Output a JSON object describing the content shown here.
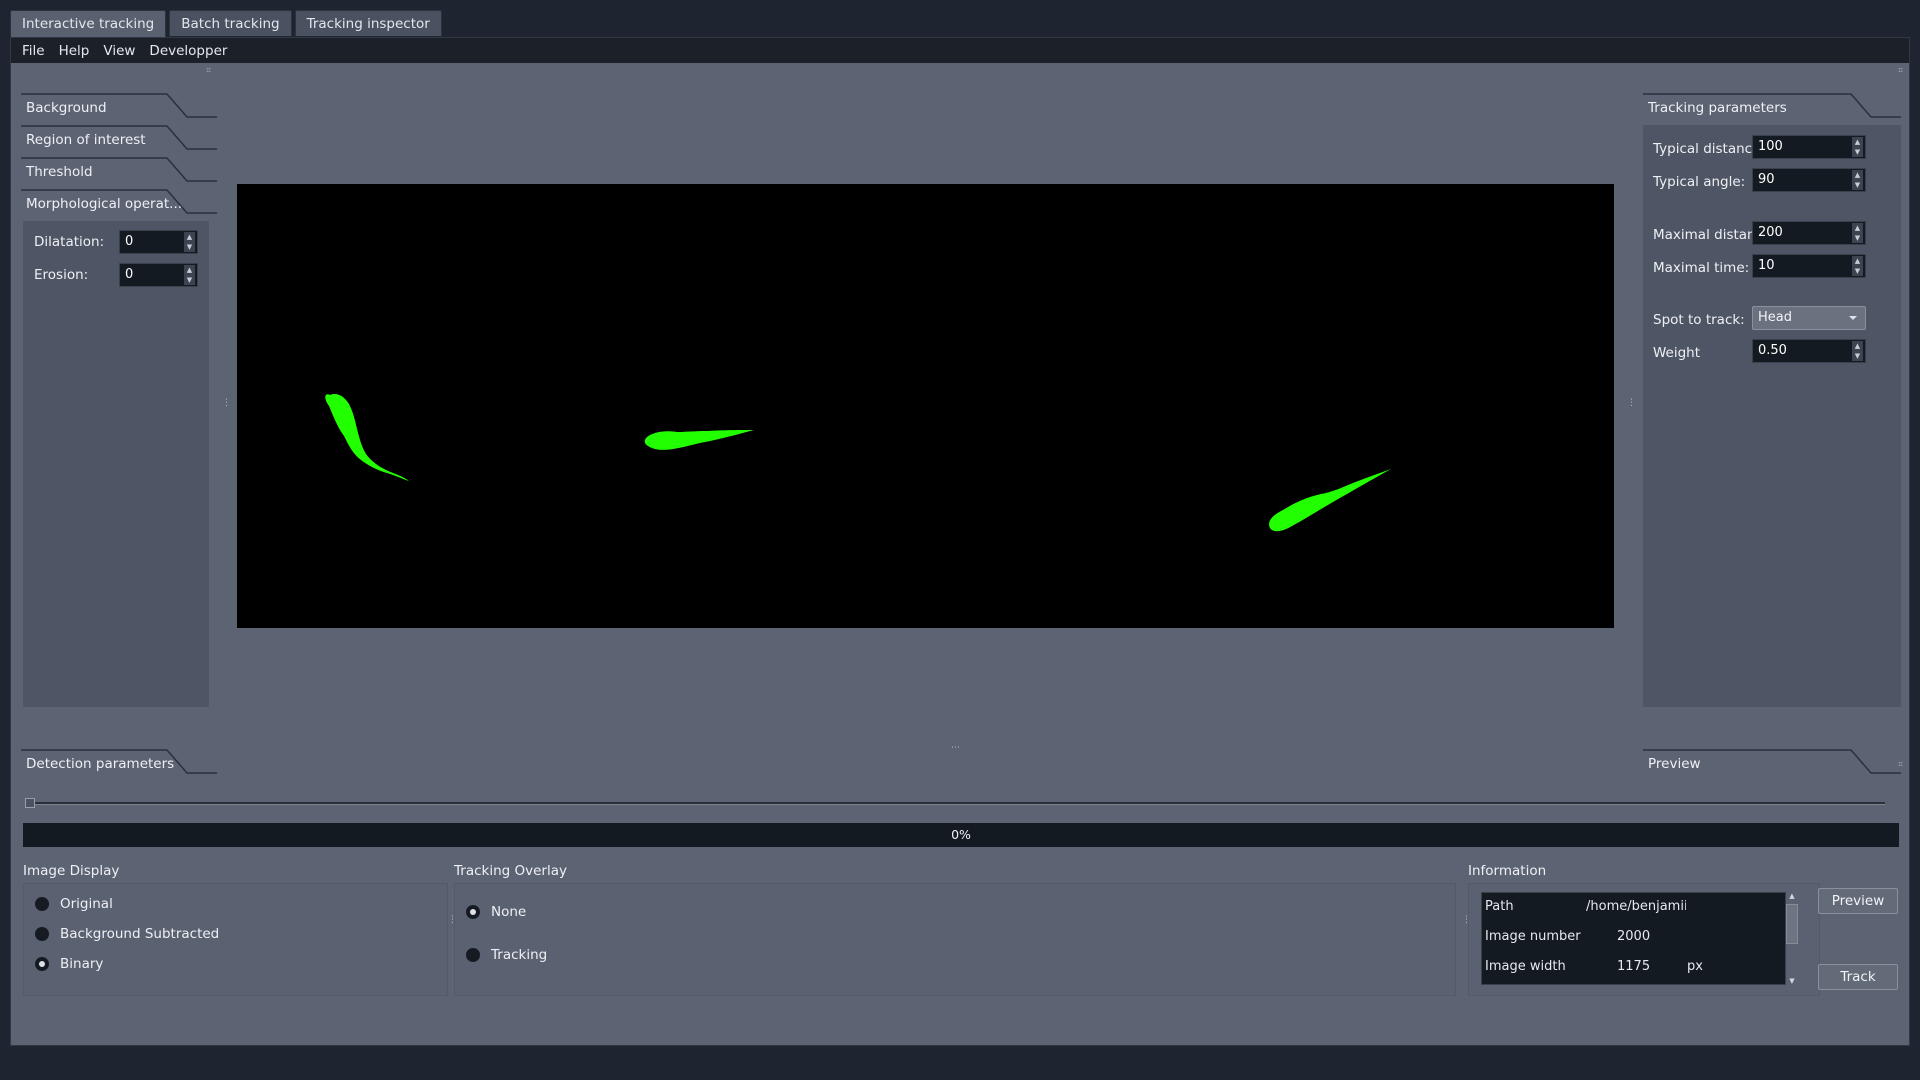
{
  "tabs": [
    "Interactive tracking",
    "Batch tracking",
    "Tracking inspector"
  ],
  "menu": [
    "File",
    "Help",
    "View",
    "Developper"
  ],
  "left_panel": {
    "sections": [
      "Background",
      "Region of interest",
      "Threshold",
      "Morphological operat..."
    ],
    "fields": [
      {
        "label": "Dilatation:",
        "value": "0"
      },
      {
        "label": "Erosion:",
        "value": "0"
      }
    ],
    "bottom_tab": "Detection parameters"
  },
  "right_panel": {
    "title": "Tracking parameters",
    "fields": [
      {
        "label": "Typical distance:",
        "value": "100"
      },
      {
        "label": "Typical angle:",
        "value": "90"
      },
      {
        "label": "Maximal distance:",
        "value": "200"
      },
      {
        "label": "Maximal time:",
        "value": "10"
      }
    ],
    "spot_label": "Spot to track:",
    "spot_value": "Head",
    "weight_label": "Weight",
    "weight_value": "0.50",
    "bottom_tab": "Preview"
  },
  "progress": {
    "text": "0%",
    "fraction": 0
  },
  "slider": {
    "value": 0
  },
  "image_display": {
    "title": "Image Display",
    "options": [
      {
        "label": "Original",
        "checked": false
      },
      {
        "label": "Background Subtracted",
        "checked": false
      },
      {
        "label": "Binary",
        "checked": true
      }
    ]
  },
  "tracking_overlay": {
    "title": "Tracking Overlay",
    "options": [
      {
        "label": "None",
        "checked": true
      },
      {
        "label": "Tracking",
        "checked": false
      }
    ]
  },
  "information": {
    "title": "Information",
    "rows": [
      {
        "key": "Path",
        "value": "/home/benjamii",
        "unit": ""
      },
      {
        "key": "Image number",
        "value": "2000",
        "unit": ""
      },
      {
        "key": "Image width",
        "value": "1175",
        "unit": "px"
      }
    ]
  },
  "buttons": {
    "preview": "Preview",
    "track": "Track"
  },
  "colors": {
    "accent_green": "#22ff00",
    "viewer_bg": "#000000"
  }
}
